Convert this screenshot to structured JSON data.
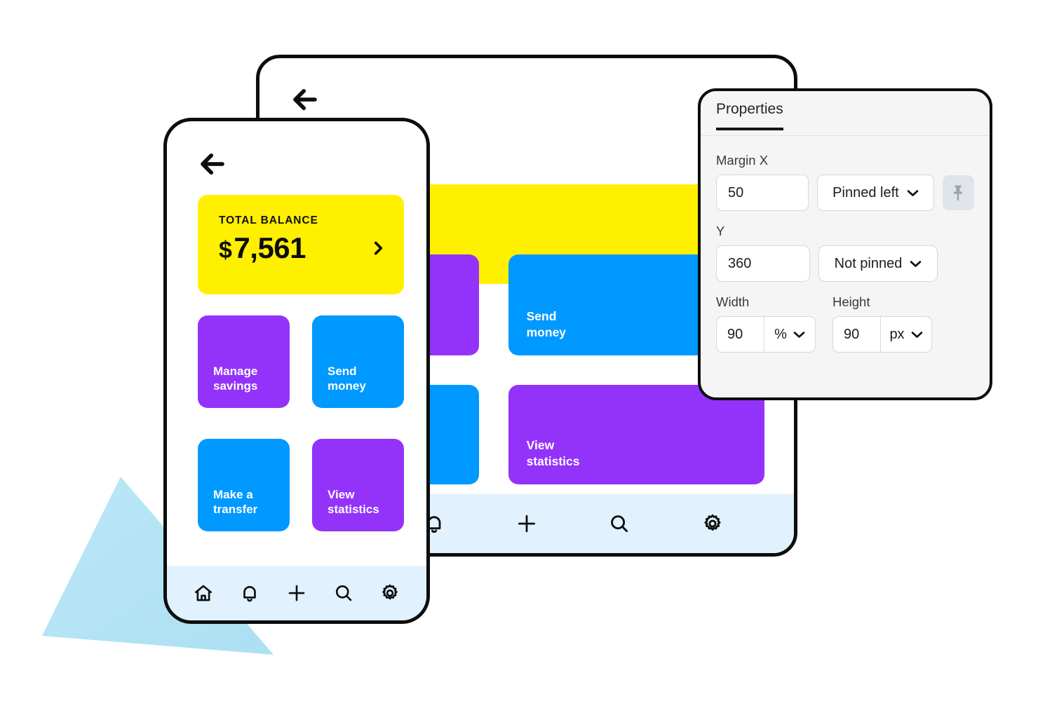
{
  "colors": {
    "yellow": "#FFF000",
    "purple": "#9333FA",
    "blue": "#0099FF",
    "nav_background": "#E1F1FD",
    "panel_background": "#F5F5F5",
    "frame_border": "#0D0D0D",
    "triangle": "#AEE3F5",
    "pin_button_background": "#DFE5EA",
    "pin_icon": "#9AA5A5"
  },
  "phone": {
    "back_icon": "arrow-left-icon",
    "balance_card": {
      "label": "TOTAL BALANCE",
      "currency": "$",
      "amount": "7,561",
      "chevron_icon": "chevron-right-icon"
    },
    "action_cards": [
      {
        "label": "Manage\nsavings",
        "color": "purple"
      },
      {
        "label": "Send\nmoney",
        "color": "blue"
      },
      {
        "label": "Make a\ntransfer",
        "color": "blue"
      },
      {
        "label": "View\nstatistics",
        "color": "purple"
      }
    ],
    "nav_items": [
      {
        "icon": "home-icon"
      },
      {
        "icon": "bell-icon"
      },
      {
        "icon": "plus-icon"
      },
      {
        "icon": "search-icon"
      },
      {
        "icon": "gear-icon"
      }
    ]
  },
  "tablet": {
    "back_icon": "arrow-left-icon",
    "hero_color": "yellow",
    "action_cards": [
      {
        "label": "",
        "color": "purple"
      },
      {
        "label": "Send\nmoney",
        "color": "blue"
      },
      {
        "label": "",
        "color": "blue"
      },
      {
        "label": "View\nstatistics",
        "color": "purple"
      }
    ],
    "nav_items": [
      {
        "icon": "plus-icon"
      },
      {
        "icon": "search-icon"
      },
      {
        "icon": "gear-icon"
      }
    ]
  },
  "properties_panel": {
    "tabs": [
      {
        "label": "Properties",
        "active": true
      }
    ],
    "fields": {
      "margin_x": {
        "label": "Margin X",
        "value": "50",
        "pin_mode": "Pinned left",
        "pin_button_icon": "pushpin-icon"
      },
      "y": {
        "label": "Y",
        "value": "360",
        "pin_mode": "Not pinned"
      },
      "width": {
        "label": "Width",
        "value": "90",
        "unit": "%"
      },
      "height": {
        "label": "Height",
        "value": "90",
        "unit": "px"
      }
    }
  }
}
